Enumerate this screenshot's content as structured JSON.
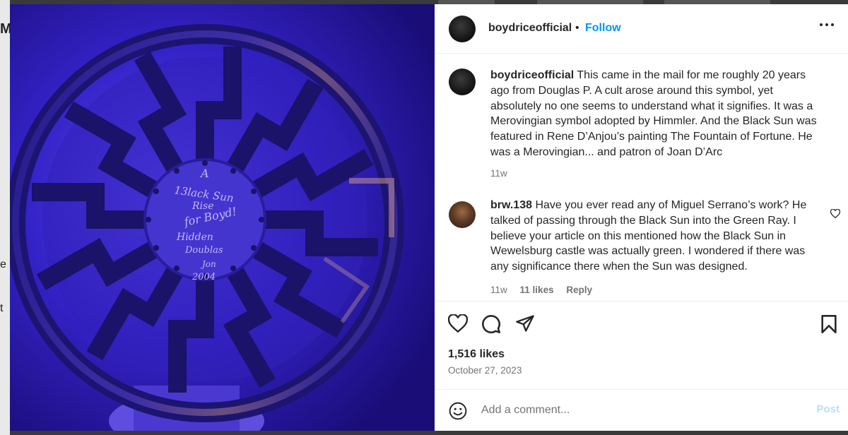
{
  "post": {
    "author": "boydriceofficial",
    "separator": "•",
    "follow_label": "Follow"
  },
  "caption": {
    "author": "boydriceofficial",
    "text": "This came in the mail for me roughly 20 years ago from Douglas P. A cult arose around this symbol, yet absolutely no one seems to understand what it signifies. It was a Merovingian symbol adopted by Himmler. And the Black Sun was featured in Rene D’Anjou’s painting The Fountain of Fortune. He was a Merovingian... and patron of Joan D’Arc",
    "time": "11w"
  },
  "comments": [
    {
      "author": "brw.138",
      "text": "Have you ever read any of Miguel Serrano’s work? He talked of passing through the Black Sun into the Green Ray. I believe your article on this mentioned how the Black Sun in Wewelsburg castle was actually green. I wondered if there was any significance there when the Sun was designed.",
      "time": "11w",
      "likes": "11 likes",
      "reply_label": "Reply"
    }
  ],
  "stats": {
    "likes": "1,516 likes",
    "date": "October 27, 2023"
  },
  "add_comment": {
    "placeholder": "Add a comment...",
    "post_label": "Post"
  },
  "icons": {
    "like": "heart-icon",
    "comment": "comment-icon",
    "share": "share-icon",
    "save": "bookmark-icon",
    "emoji": "emoji-icon",
    "more": "more-options-icon",
    "comment_like": "small-heart-icon"
  },
  "photo": {
    "handwriting": [
      "A",
      "13lack Sun",
      "Rise",
      "for Boyd!",
      "Hidden",
      "Doublas",
      "Jon",
      "2004"
    ]
  },
  "left_edge_glyphs": [
    "M",
    "e",
    "t"
  ],
  "colors": {
    "accent": "#0095f6",
    "post_disabled": "#b8dcfa",
    "secondary_text": "#737373",
    "photo_purple": "#3423c4"
  }
}
